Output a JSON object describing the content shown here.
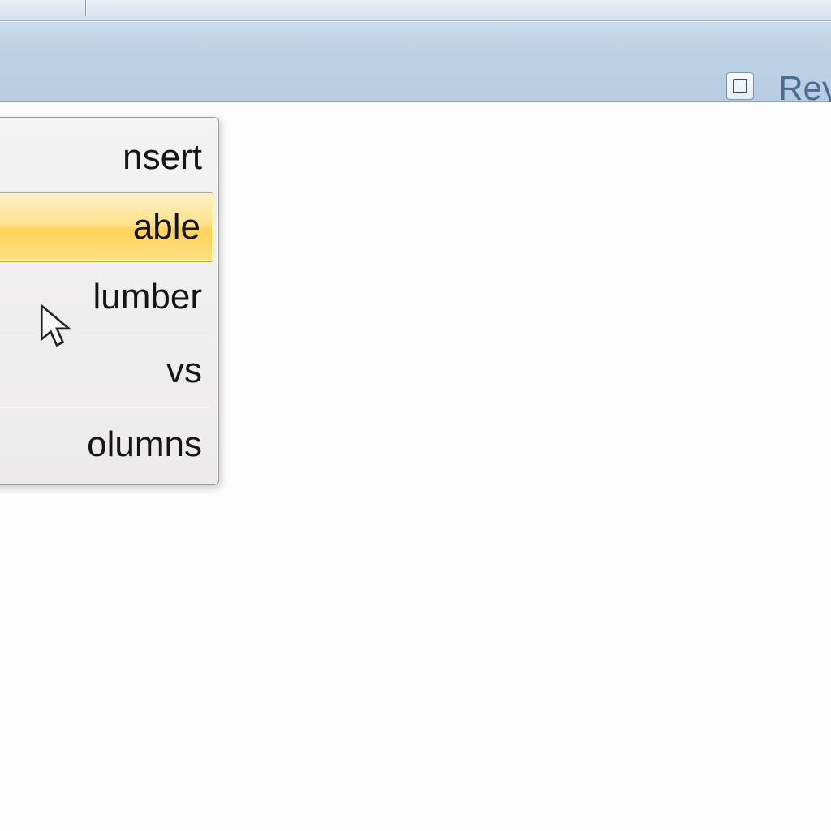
{
  "ribbon": {
    "right_label": "Rey"
  },
  "menu": {
    "items": [
      {
        "label": "nsert",
        "highlight": false
      },
      {
        "label": "able",
        "highlight": true
      },
      {
        "label": "lumber",
        "highlight": false
      },
      {
        "label": "vs",
        "highlight": false
      },
      {
        "label": "olumns",
        "highlight": false
      }
    ]
  }
}
